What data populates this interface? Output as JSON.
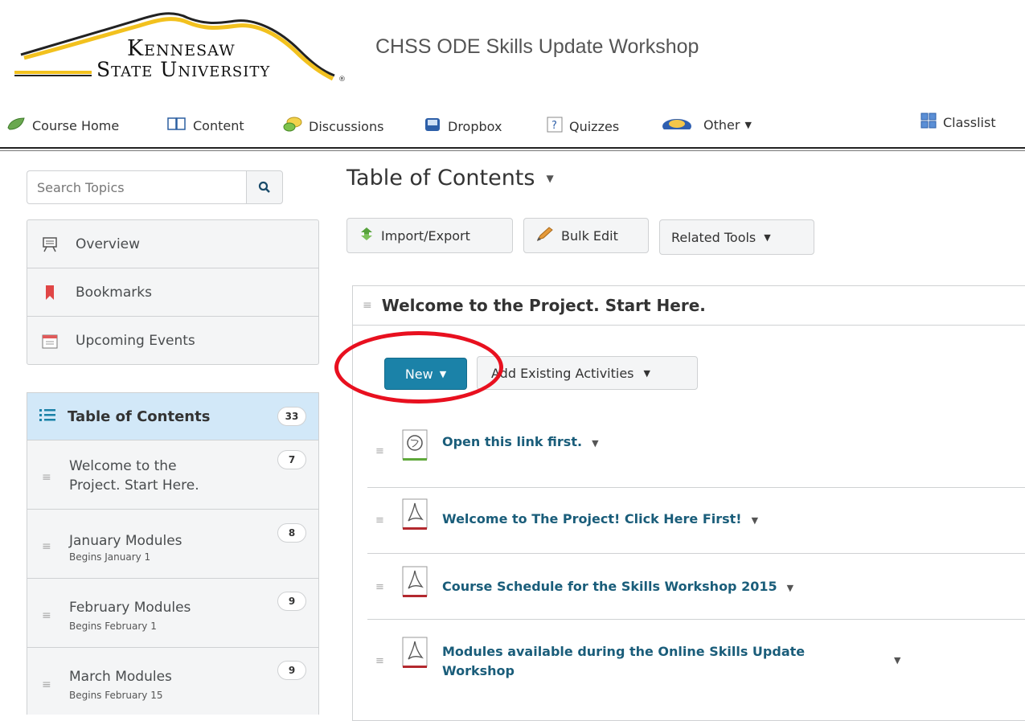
{
  "header": {
    "logo_line1": "Kennesaw",
    "logo_line2": "State University",
    "logo_reg": "®",
    "course_title": "CHSS ODE Skills Update Workshop"
  },
  "nav": {
    "items": [
      {
        "label": "Course Home",
        "icon": "course-home-icon"
      },
      {
        "label": "Content",
        "icon": "book-icon"
      },
      {
        "label": "Discussions",
        "icon": "speech-bubbles-icon"
      },
      {
        "label": "Dropbox",
        "icon": "dropbox-icon"
      },
      {
        "label": "Quizzes",
        "icon": "quiz-icon"
      },
      {
        "label": "Other",
        "icon": "globe-icon"
      },
      {
        "label": "Classlist",
        "icon": "classlist-icon"
      }
    ]
  },
  "sidebar": {
    "search_placeholder": "Search Topics",
    "links": [
      {
        "label": "Overview",
        "icon": "overview-icon"
      },
      {
        "label": "Bookmarks",
        "icon": "bookmark-icon"
      },
      {
        "label": "Upcoming Events",
        "icon": "calendar-icon"
      }
    ],
    "toc": {
      "label": "Table of Contents",
      "count": "33",
      "modules": [
        {
          "label": "Welcome to the Project. Start Here.",
          "sub": "",
          "count": "7"
        },
        {
          "label": "January Modules",
          "sub": "Begins January 1",
          "count": "8"
        },
        {
          "label": "February Modules",
          "sub": "Begins February 1",
          "count": "9"
        },
        {
          "label": "March Modules",
          "sub": "Begins February 15",
          "count": "9"
        }
      ]
    }
  },
  "main": {
    "title": "Table of Contents",
    "toolbar": {
      "import_export": "Import/Export",
      "bulk_edit": "Bulk Edit",
      "related_tools": "Related Tools"
    },
    "module": {
      "title": "Welcome to the Project. Start Here.",
      "new_label": "New",
      "add_existing_label": "Add Existing Activities",
      "topics": [
        {
          "title": "Open this link first.",
          "type": "link"
        },
        {
          "title": "Welcome to The Project! Click Here First!",
          "type": "pdf"
        },
        {
          "title": "Course Schedule for the Skills Workshop 2015",
          "type": "pdf"
        },
        {
          "title_line1": "Modules available during the Online Skills Update",
          "title_line2": "Workshop",
          "type": "pdf"
        }
      ]
    }
  },
  "colors": {
    "primary_button": "#1b82a8",
    "link": "#1a5d7a",
    "toc_highlight": "#d2e8f8",
    "annotation_circle": "#e8101f"
  }
}
